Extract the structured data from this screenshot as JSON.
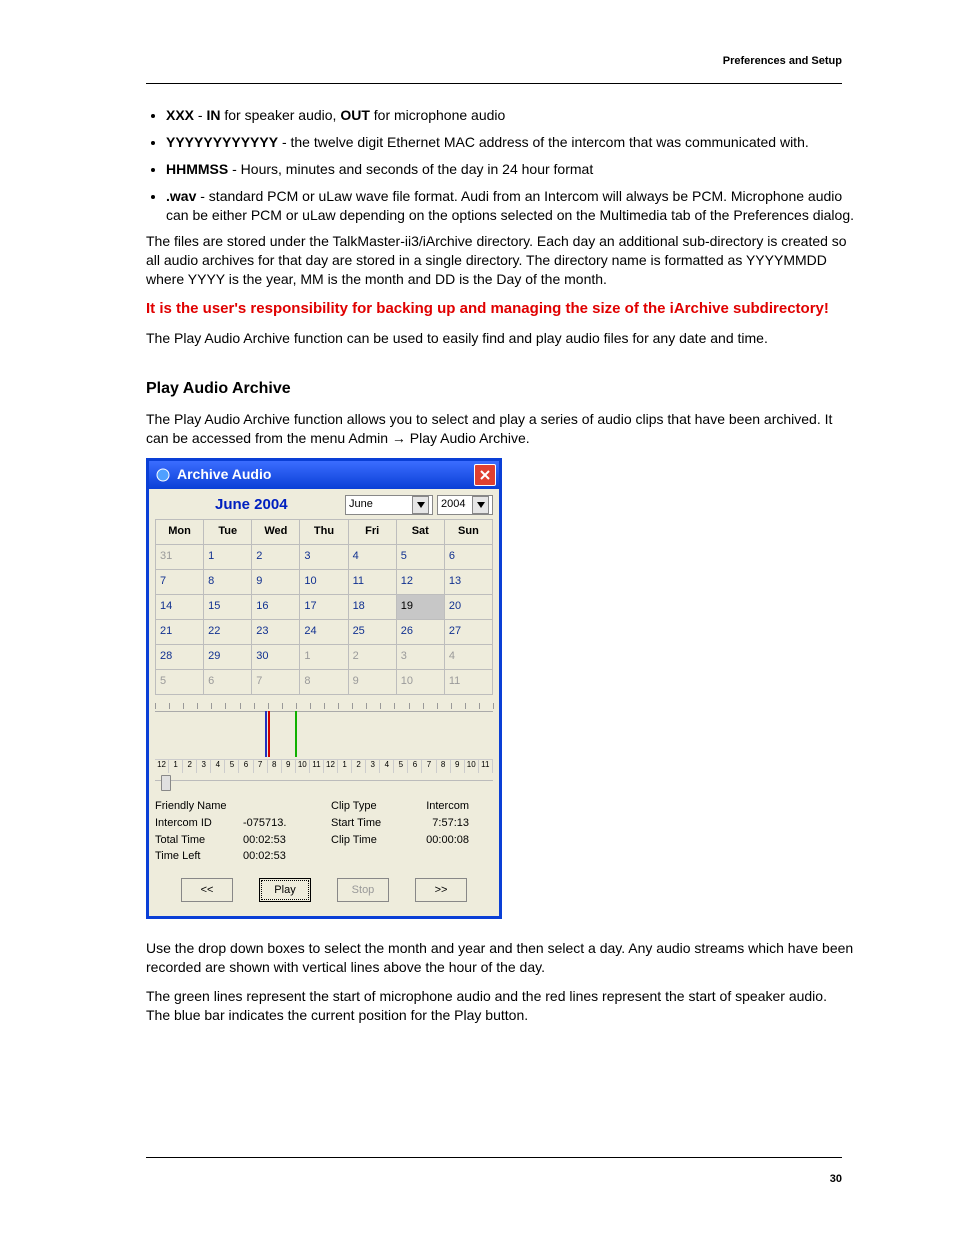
{
  "header": {
    "section": "Preferences and Setup"
  },
  "page_number": "30",
  "bullets": {
    "b1_strong1": "XXX",
    "b1_mid": " - ",
    "b1_strong2": "IN",
    "b1_text1": " for speaker audio, ",
    "b1_strong3": "OUT",
    "b1_text2": " for microphone audio",
    "b2_strong": "YYYYYYYYYYYY",
    "b2_text": " - the twelve digit Ethernet MAC address of the intercom that was communicated with.",
    "b3_strong": "HHMMSS",
    "b3_text": " - Hours, minutes and seconds of the day in 24 hour format",
    "b4_strong": ".wav",
    "b4_text": " - standard PCM or uLaw wave file format. Audi from an Intercom will always be PCM. Microphone audio can be either PCM or uLaw depending on the options selected on the Multimedia tab of the Preferences dialog."
  },
  "p_storage": "The files are stored under the TalkMaster-ii3/iArchive directory.  Each day an additional sub-directory is created so all audio archives for that day are stored in a single directory.  The directory name is formatted as YYYYMMDD where YYYY is the year, MM is the month and DD is the Day of the month.",
  "p_warn": "It is the user's responsibility for backing up and managing the size of the iArchive subdirectory!",
  "p_note": "The Play Audio Archive function can be used to easily find and play audio files for any date and time.",
  "section_title": "Play Audio Archive",
  "p_func": "The Play Audio Archive function allows you to select and play a series of audio clips that have been archived. It can be accessed from the menu Admin → Play Audio Archive.",
  "dialog": {
    "title": "Archive Audio",
    "month_year_label": "June 2004",
    "month_select": "June",
    "year_select": "2004",
    "days": [
      "Mon",
      "Tue",
      "Wed",
      "Thu",
      "Fri",
      "Sat",
      "Sun"
    ],
    "cal": [
      [
        {
          "n": "31",
          "c": "other"
        },
        {
          "n": "1",
          "c": "cur"
        },
        {
          "n": "2",
          "c": "cur"
        },
        {
          "n": "3",
          "c": "cur"
        },
        {
          "n": "4",
          "c": "cur"
        },
        {
          "n": "5",
          "c": "cur"
        },
        {
          "n": "6",
          "c": "cur"
        }
      ],
      [
        {
          "n": "7",
          "c": "cur"
        },
        {
          "n": "8",
          "c": "cur"
        },
        {
          "n": "9",
          "c": "cur"
        },
        {
          "n": "10",
          "c": "cur"
        },
        {
          "n": "11",
          "c": "cur"
        },
        {
          "n": "12",
          "c": "cur"
        },
        {
          "n": "13",
          "c": "cur"
        }
      ],
      [
        {
          "n": "14",
          "c": "cur"
        },
        {
          "n": "15",
          "c": "cur"
        },
        {
          "n": "16",
          "c": "cur"
        },
        {
          "n": "17",
          "c": "cur"
        },
        {
          "n": "18",
          "c": "cur"
        },
        {
          "n": "19",
          "c": "sel"
        },
        {
          "n": "20",
          "c": "cur"
        }
      ],
      [
        {
          "n": "21",
          "c": "cur"
        },
        {
          "n": "22",
          "c": "cur"
        },
        {
          "n": "23",
          "c": "cur"
        },
        {
          "n": "24",
          "c": "cur"
        },
        {
          "n": "25",
          "c": "cur"
        },
        {
          "n": "26",
          "c": "cur"
        },
        {
          "n": "27",
          "c": "cur"
        }
      ],
      [
        {
          "n": "28",
          "c": "cur"
        },
        {
          "n": "29",
          "c": "cur"
        },
        {
          "n": "30",
          "c": "cur"
        },
        {
          "n": "1",
          "c": "other"
        },
        {
          "n": "2",
          "c": "other"
        },
        {
          "n": "3",
          "c": "other"
        },
        {
          "n": "4",
          "c": "other"
        }
      ],
      [
        {
          "n": "5",
          "c": "other"
        },
        {
          "n": "6",
          "c": "other"
        },
        {
          "n": "7",
          "c": "other"
        },
        {
          "n": "8",
          "c": "other"
        },
        {
          "n": "9",
          "c": "other"
        },
        {
          "n": "10",
          "c": "other"
        },
        {
          "n": "11",
          "c": "other"
        }
      ]
    ],
    "hours": [
      "12",
      "1",
      "2",
      "3",
      "4",
      "5",
      "6",
      "7",
      "8",
      "9",
      "10",
      "11",
      "12",
      "1",
      "2",
      "3",
      "4",
      "5",
      "6",
      "7",
      "8",
      "9",
      "10",
      "11"
    ],
    "marks": [
      {
        "pos": 32.5,
        "cls": "blue"
      },
      {
        "pos": 33.3,
        "cls": "red"
      },
      {
        "pos": 41.5,
        "cls": "green"
      }
    ],
    "labels": {
      "friendly_name": "Friendly Name",
      "intercom_id": "Intercom ID",
      "total_time": "Total Time",
      "time_left": "Time Left",
      "clip_type": "Clip Type",
      "start_time": "Start Time",
      "clip_time": "Clip Time"
    },
    "values": {
      "friendly_name": "",
      "intercom_id": "-075713.",
      "total_time": "00:02:53",
      "time_left": "00:02:53",
      "clip_type": "Intercom",
      "start_time": "7:57:13",
      "clip_time": "00:00:08"
    },
    "buttons": {
      "prev": "<<",
      "play": "Play",
      "stop": "Stop",
      "next": ">>"
    }
  },
  "p_after1": "Use the drop down boxes to select the month and year and then select a day.  Any audio streams which have been recorded are shown with vertical lines above the hour of the day.",
  "p_after2": "The green lines represent the start of microphone audio and the red lines represent the start of speaker audio.  The blue bar indicates the current position for the Play button."
}
